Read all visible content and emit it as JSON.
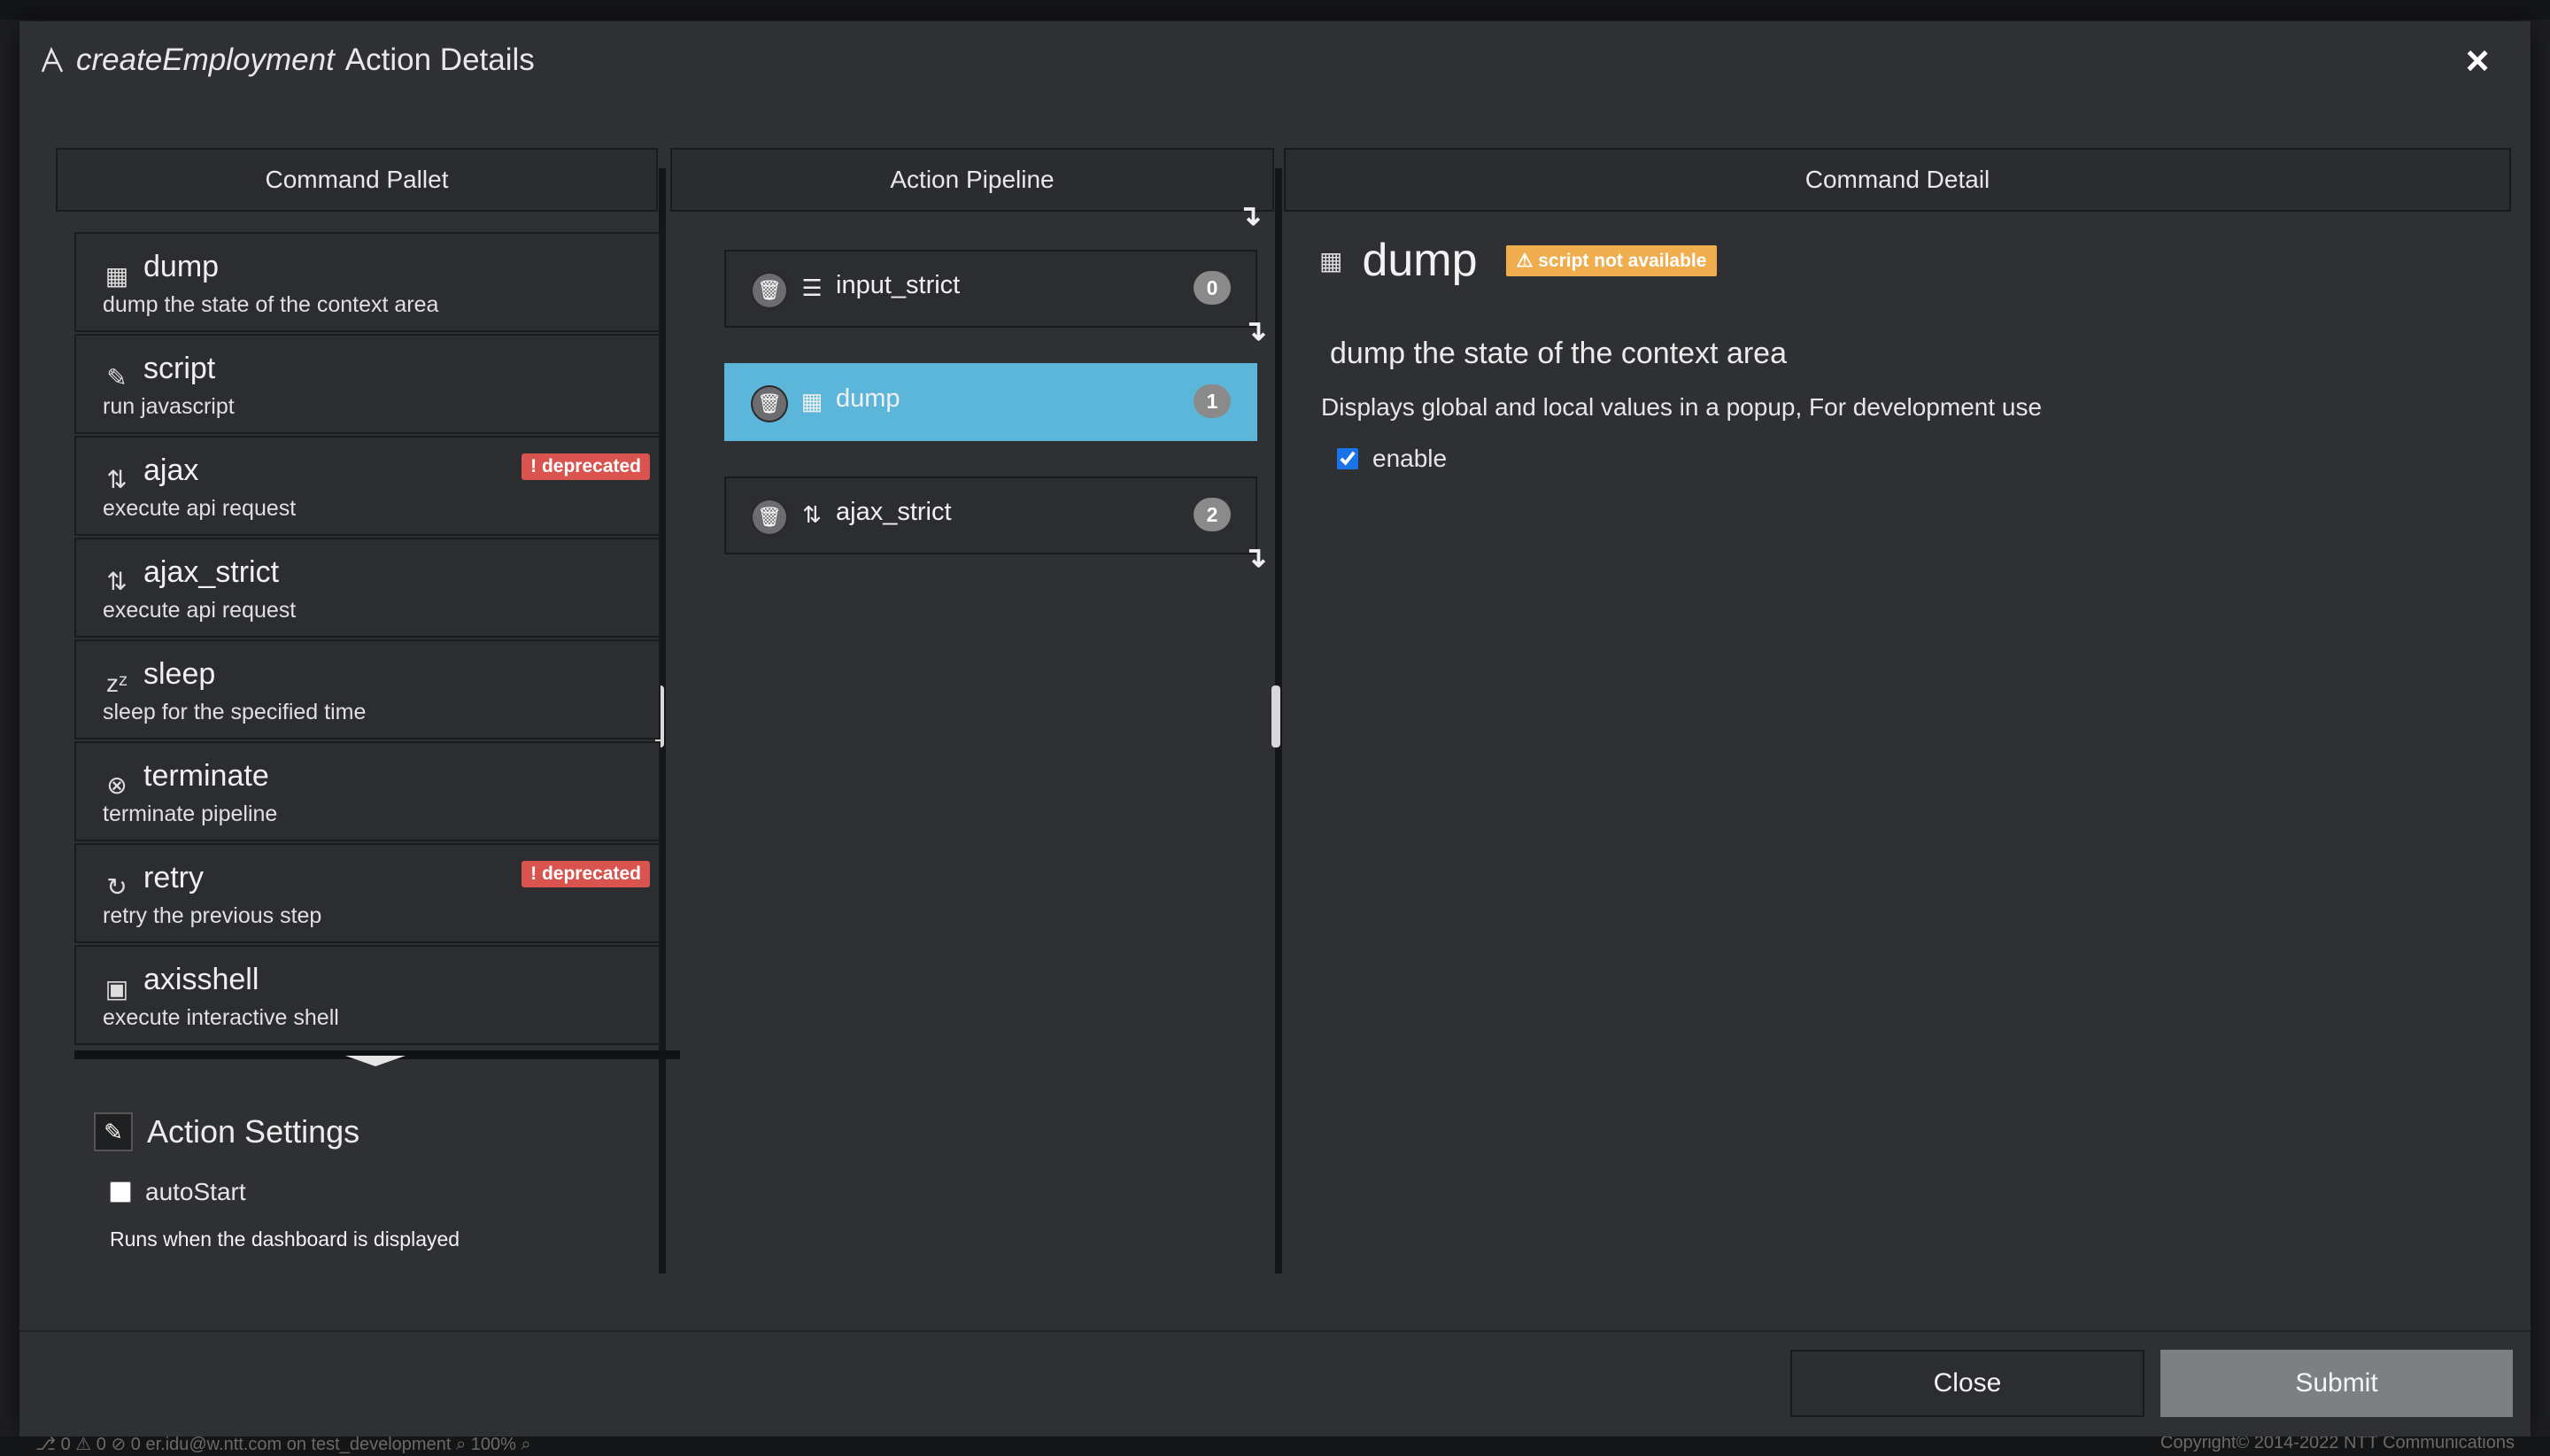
{
  "modal": {
    "title_name": "createEmployment",
    "title_suffix": "Action Details",
    "close_icon": "×"
  },
  "columns": {
    "pallet": "Command Pallet",
    "pipeline": "Action Pipeline",
    "detail": "Command Detail"
  },
  "pallet": {
    "items": [
      {
        "name": "dump",
        "desc": "dump the state of the context area",
        "icon": "dump-icon",
        "glyph": "▦"
      },
      {
        "name": "script",
        "desc": "run javascript",
        "icon": "script-icon",
        "glyph": "✎"
      },
      {
        "name": "ajax",
        "desc": "execute api request",
        "icon": "ajax-icon",
        "glyph": "⇅",
        "badge": "deprecated"
      },
      {
        "name": "ajax_strict",
        "desc": "execute api request",
        "icon": "ajax-icon",
        "glyph": "⇅"
      },
      {
        "name": "sleep",
        "desc": "sleep for the specified time",
        "icon": "sleep-icon",
        "glyph": "zᶻ"
      },
      {
        "name": "terminate",
        "desc": "terminate pipeline",
        "icon": "terminate-icon",
        "glyph": "⊗"
      },
      {
        "name": "retry",
        "desc": "retry the previous step",
        "icon": "retry-icon",
        "glyph": "↻",
        "badge": "deprecated"
      },
      {
        "name": "axisshell",
        "desc": "execute interactive shell",
        "icon": "terminal-icon",
        "glyph": "▣"
      }
    ],
    "badge_deprecated": "deprecated"
  },
  "settings": {
    "title": "Action Settings",
    "autostart_label": "autoStart",
    "autostart_checked": false,
    "hint": "Runs when the dashboard is displayed"
  },
  "pipeline": {
    "items": [
      {
        "label": "input_strict",
        "index": "0",
        "icon": "input-icon",
        "glyph": "☰"
      },
      {
        "label": "dump",
        "index": "1",
        "icon": "dump-icon",
        "glyph": "▦",
        "active": true
      },
      {
        "label": "ajax_strict",
        "index": "2",
        "icon": "ajax-icon",
        "glyph": "⇅"
      }
    ]
  },
  "detail": {
    "name": "dump",
    "warning_badge": "script not available",
    "summary": "dump the state of the context area",
    "description": "Displays global and local values in a popup, For development use",
    "enable_label": "enable",
    "enable_checked": true
  },
  "footer": {
    "close_label": "Close",
    "submit_label": "Submit"
  },
  "statusbar": {
    "left": "⎇ 0 ⚠ 0 ⊘ 0   er.idu@w.ntt.com   on   test_development   ⌕ 100% ⌕",
    "right": "Copyright© 2014-2022 NTT Communications"
  },
  "colors": {
    "modal_bg": "#2e3033",
    "active_item": "#5bb6da",
    "deprecated": "#d9534f",
    "warning": "#f0ad4e",
    "submit": "#7d8082"
  }
}
